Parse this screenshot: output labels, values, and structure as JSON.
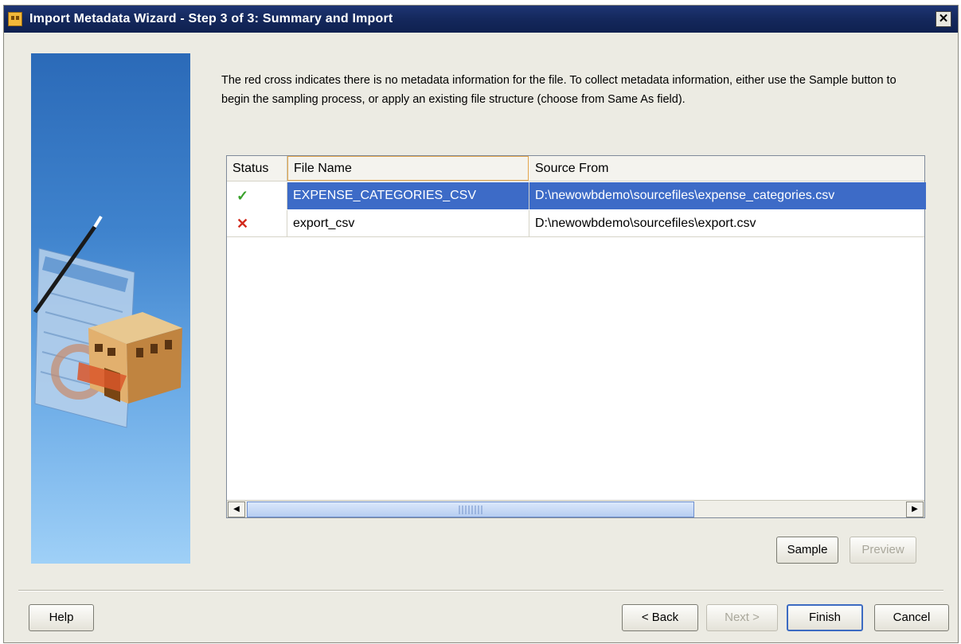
{
  "window": {
    "title": "Import Metadata Wizard - Step 3 of 3: Summary and Import",
    "close_glyph": "✕"
  },
  "instructions": "The red cross indicates there is no metadata information for the file. To collect metadata information, either use the Sample button to begin the sampling process, or apply an existing file structure (choose from Same As field).",
  "table": {
    "columns": [
      "Status",
      "File Name",
      "Source From"
    ],
    "rows": [
      {
        "status_icon": "checkmark-icon",
        "status_glyph": "✓",
        "file_name": "EXPENSE_CATEGORIES_CSV",
        "source_from": "D:\\newowbdemo\\sourcefiles\\expense_categories.csv",
        "selected": true
      },
      {
        "status_icon": "red-cross-icon",
        "status_glyph": "✕",
        "file_name": "export_csv",
        "source_from": "D:\\newowbdemo\\sourcefiles\\export.csv",
        "selected": false
      }
    ]
  },
  "scroll": {
    "left_glyph": "◀",
    "right_glyph": "▶"
  },
  "buttons": {
    "sample": "Sample",
    "preview": "Preview",
    "help": "Help",
    "back": "< Back",
    "next": "Next >",
    "finish": "Finish",
    "cancel": "Cancel"
  },
  "colors": {
    "title_bar": "#14285c",
    "selection": "#3d6bc7",
    "check": "#39a12b",
    "cross": "#d22a1c"
  }
}
